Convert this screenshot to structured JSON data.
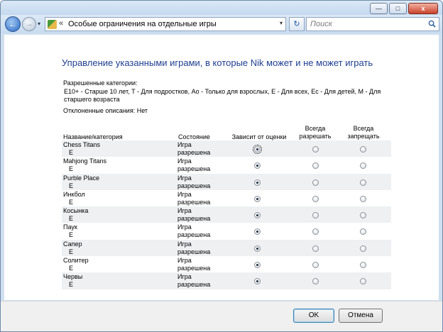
{
  "window": {
    "minimize": "—",
    "maximize": "□",
    "close": "x"
  },
  "nav": {
    "back": "←",
    "forward": "→",
    "dropdown": "▾",
    "address_sep": "«",
    "address": "Особые ограничения на отдельные игры",
    "address_dropdown": "▾",
    "refresh": "↻",
    "search_placeholder": "Поиск"
  },
  "page": {
    "heading": "Управление указанными играми, в которые Nik может и не может играть",
    "allowed_label": "Разрешенные категории:",
    "allowed_text": "E10+ - Старше 10 лет, T - Для подростков, Ao - Только для взрослых, E - Для всех, Ec - Для детей, M - Для старшего возраста",
    "rejected": "Отклоненные описания:  Нет"
  },
  "table": {
    "headers": {
      "name": "Название/категория",
      "state": "Состояние",
      "depends": "Зависит от оценки",
      "always_allow": "Всегда разрешать",
      "always_block": "Всегда запрещать"
    },
    "rows": [
      {
        "name": "Chess Titans",
        "rating": "E",
        "state": "Игра разрешена",
        "selected": "depends"
      },
      {
        "name": "Mahjong Titans",
        "rating": "E",
        "state": "Игра разрешена",
        "selected": "depends"
      },
      {
        "name": "Purble Place",
        "rating": "E",
        "state": "Игра разрешена",
        "selected": "depends"
      },
      {
        "name": "Инкбол",
        "rating": "E",
        "state": "Игра разрешена",
        "selected": "depends"
      },
      {
        "name": "Косынка",
        "rating": "E",
        "state": "Игра разрешена",
        "selected": "depends"
      },
      {
        "name": "Паук",
        "rating": "E",
        "state": "Игра разрешена",
        "selected": "depends"
      },
      {
        "name": "Сапер",
        "rating": "E",
        "state": "Игра разрешена",
        "selected": "depends"
      },
      {
        "name": "Солитер",
        "rating": "E",
        "state": "Игра разрешена",
        "selected": "depends"
      },
      {
        "name": "Червы",
        "rating": "E",
        "state": "Игра разрешена",
        "selected": "depends"
      }
    ]
  },
  "buttons": {
    "ok": "OK",
    "cancel": "Отмена"
  },
  "colors": {
    "heading": "#1f3f90",
    "row_shade": "#eef0f2",
    "chrome": "#cfe0f0"
  }
}
